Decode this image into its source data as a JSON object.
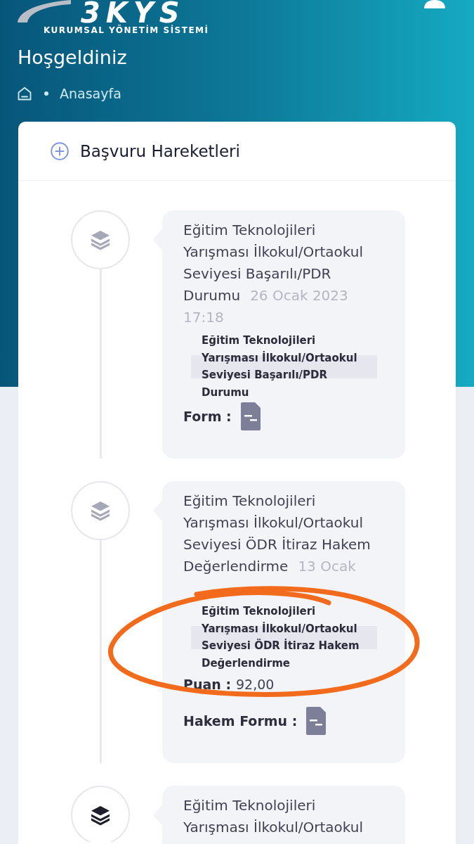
{
  "header": {
    "logo_text": "3KYS",
    "logo_subtitle": "KURUMSAL YÖNETİM SİSTEMİ",
    "title": "Hoşgeldiniz",
    "breadcrumb": [
      "Anasayfa"
    ]
  },
  "panel": {
    "title": "Başvuru Hareketleri"
  },
  "events": [
    {
      "title": "Eğitim Teknolojileri Yarışması İlkokul/Ortaokul Seviyesi Başarılı/PDR Durumu",
      "date": "26 Ocak 2023 17:18",
      "subtitle": "Eğitim Teknolojileri Yarışması İlkokul/Ortaokul Seviyesi Başarılı/PDR Durumu",
      "highlighted": false,
      "circled": false,
      "fields": [
        {
          "kind": "file",
          "label": "Form :"
        }
      ]
    },
    {
      "title": "Eğitim Teknolojileri Yarışması İlkokul/Ortaokul Seviyesi ÖDR İtiraz Hakem Değerlendirme",
      "date": "13 Ocak",
      "subtitle": "Eğitim Teknolojileri Yarışması İlkokul/Ortaokul Seviyesi ÖDR İtiraz Hakem Değerlendirme",
      "highlighted": false,
      "circled": true,
      "fields": [
        {
          "kind": "value",
          "label": "Puan :",
          "value": "92,00"
        },
        {
          "kind": "file",
          "label": "Hakem Formu :"
        }
      ]
    },
    {
      "title": "Eğitim Teknolojileri Yarışması İlkokul/Ortaokul",
      "highlighted": true,
      "circled": false
    }
  ]
}
